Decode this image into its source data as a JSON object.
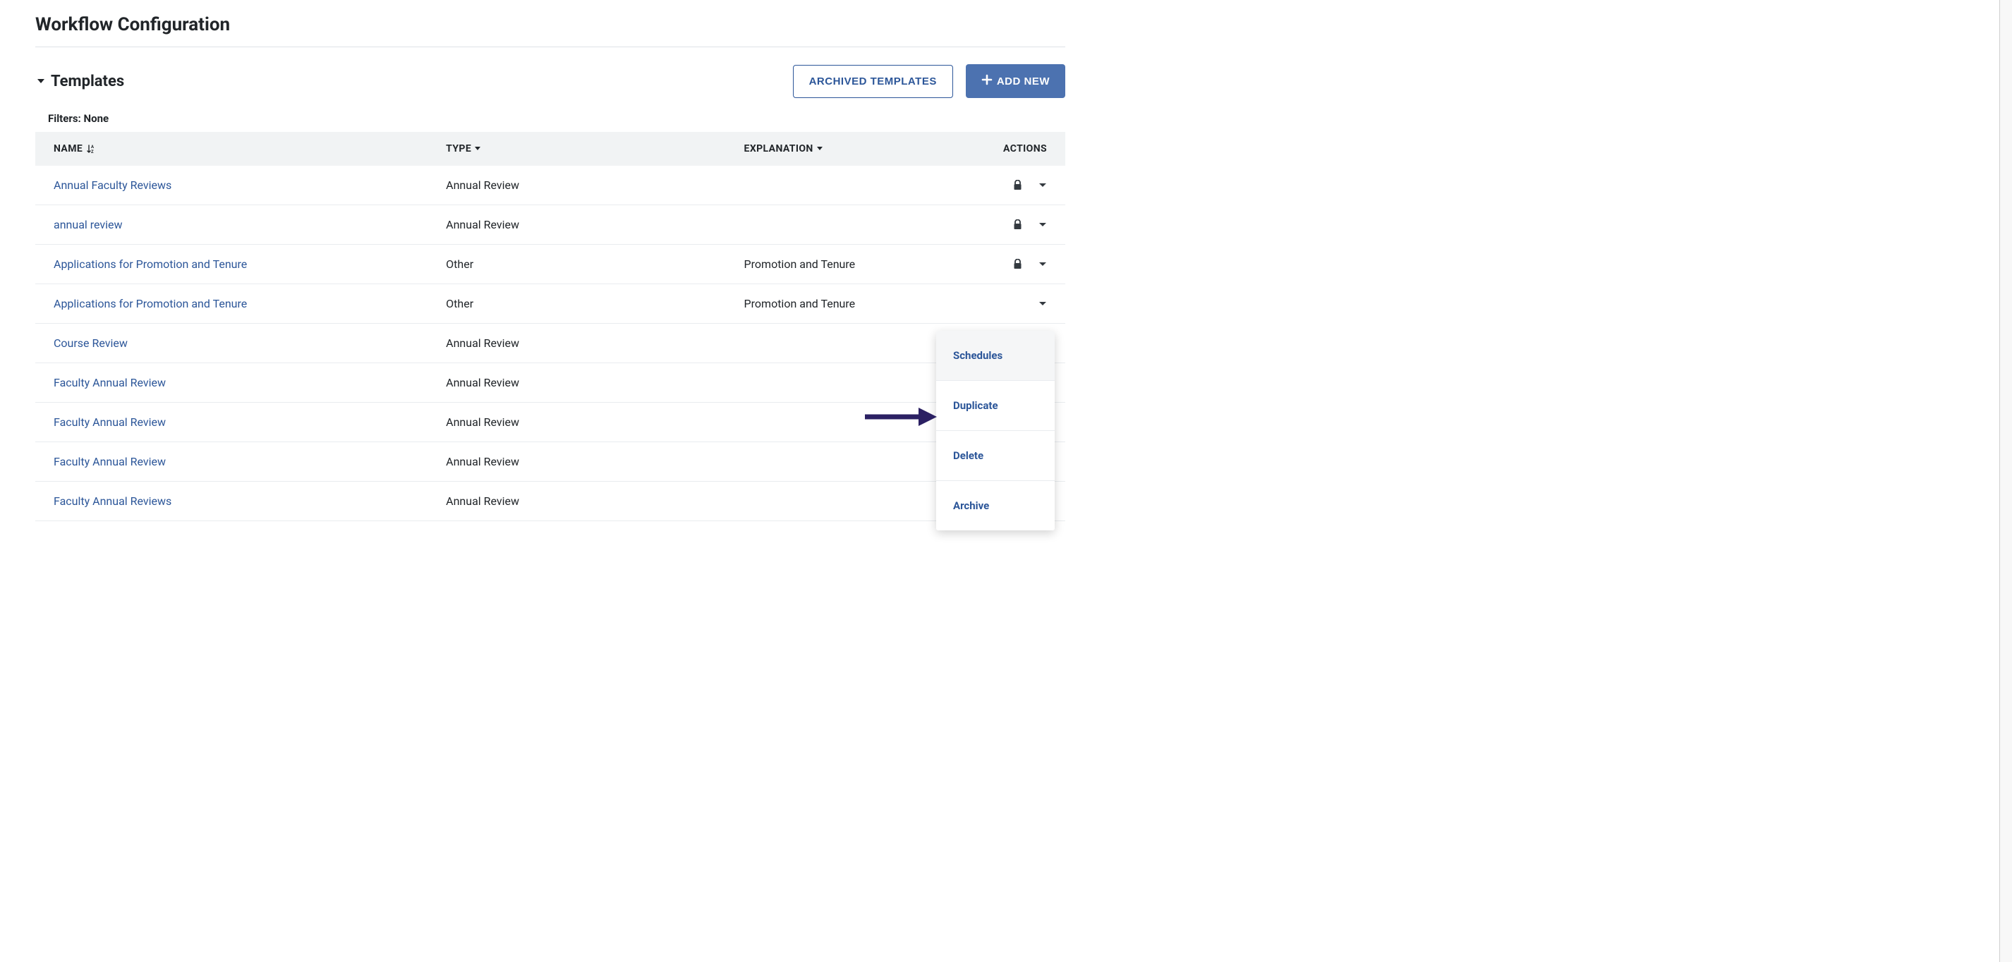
{
  "page_title": "Workflow Configuration",
  "section": {
    "title": "Templates",
    "filters_label": "Filters:",
    "filters_value": "None"
  },
  "buttons": {
    "archived": "ARCHIVED TEMPLATES",
    "add_new": "ADD NEW"
  },
  "columns": {
    "name": "NAME",
    "type": "TYPE",
    "explanation": "EXPLANATION",
    "actions": "ACTIONS"
  },
  "rows": [
    {
      "name": "Annual Faculty Reviews",
      "type": "Annual Review",
      "explanation": "",
      "locked": true
    },
    {
      "name": "annual review",
      "type": "Annual Review",
      "explanation": "",
      "locked": true
    },
    {
      "name": "Applications for Promotion and Tenure",
      "type": "Other",
      "explanation": "Promotion and Tenure",
      "locked": true
    },
    {
      "name": "Applications for Promotion and Tenure",
      "type": "Other",
      "explanation": "Promotion and Tenure",
      "locked": false
    },
    {
      "name": "Course Review",
      "type": "Annual Review",
      "explanation": "",
      "locked": false
    },
    {
      "name": "Faculty Annual Review",
      "type": "Annual Review",
      "explanation": "",
      "locked": false
    },
    {
      "name": "Faculty Annual Review",
      "type": "Annual Review",
      "explanation": "",
      "locked": false
    },
    {
      "name": "Faculty Annual Review",
      "type": "Annual Review",
      "explanation": "",
      "locked": false
    },
    {
      "name": "Faculty Annual Reviews",
      "type": "Annual Review",
      "explanation": "",
      "locked": false
    }
  ],
  "dropdown": {
    "items": [
      "Schedules",
      "Duplicate",
      "Delete",
      "Archive"
    ],
    "hovered_index": 0
  },
  "colors": {
    "link": "#2c5699",
    "primary_button": "#4c72b0",
    "annotation_arrow": "#2b2063"
  }
}
